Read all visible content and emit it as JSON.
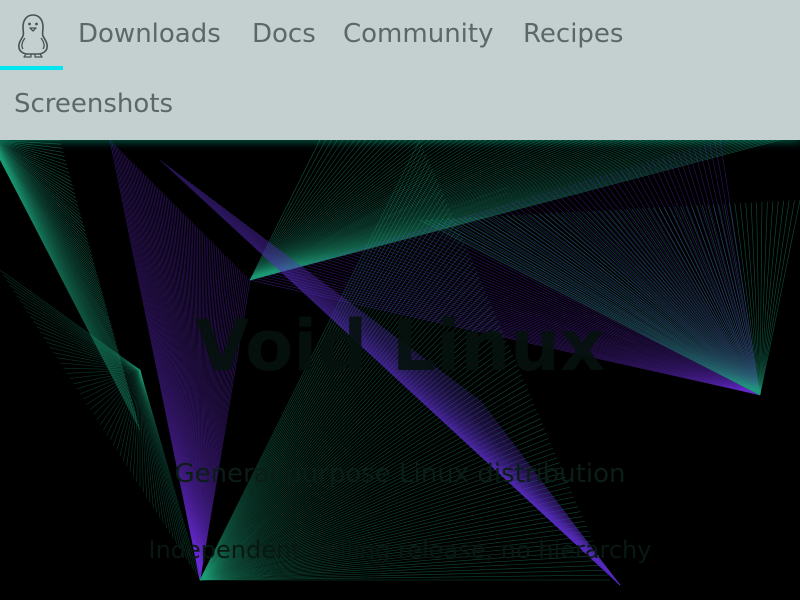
{
  "nav": {
    "logo_icon": "penguin-icon",
    "items": [
      {
        "label": "Downloads"
      },
      {
        "label": "Docs"
      },
      {
        "label": "Community"
      },
      {
        "label": "Recipes"
      },
      {
        "label": "Screenshots"
      }
    ]
  },
  "hero": {
    "title": "Void Linux",
    "tagline": "General purpose Linux distribution",
    "subtitle": "Independent, rolling release, no hierarchy"
  },
  "colors": {
    "navbar_bg": "#c3d0cf",
    "nav_text": "#5e6768",
    "active_indicator": "#00e5f0",
    "hero_bg": "#000000",
    "line_green": "#1fa07a",
    "line_purple": "#6a2bd0"
  }
}
